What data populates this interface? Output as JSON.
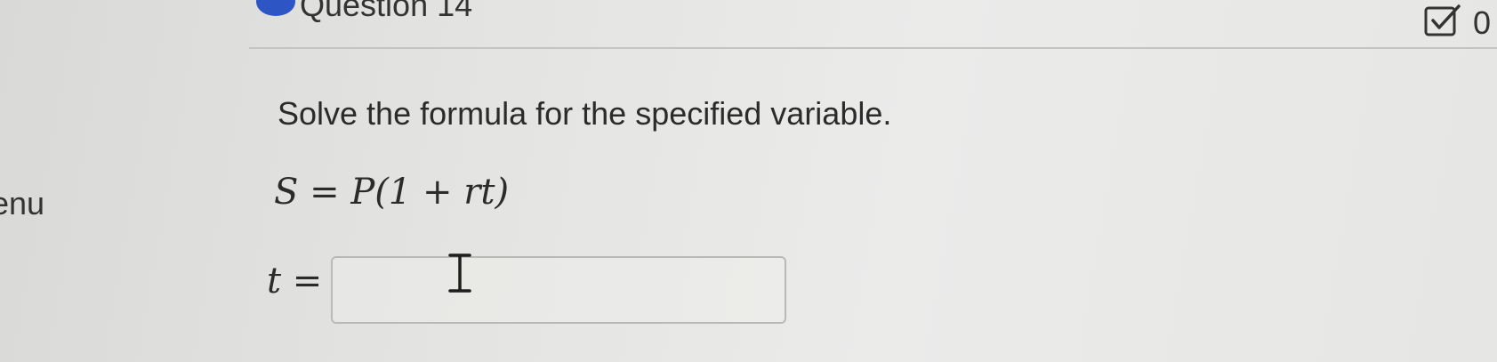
{
  "sidebar": {
    "label": "enu"
  },
  "question": {
    "title": "Question 14",
    "check_count": "0",
    "instruction": "Solve the formula for the specified variable.",
    "formula": "S = P(1 + rt)",
    "answer_label": "t =",
    "answer_value": ""
  },
  "icons": {
    "status_dot": "question-status-dot",
    "check": "checkbox-check-icon",
    "cursor": "text-cursor-icon"
  },
  "colors": {
    "status_dot": "#2d55c4"
  }
}
